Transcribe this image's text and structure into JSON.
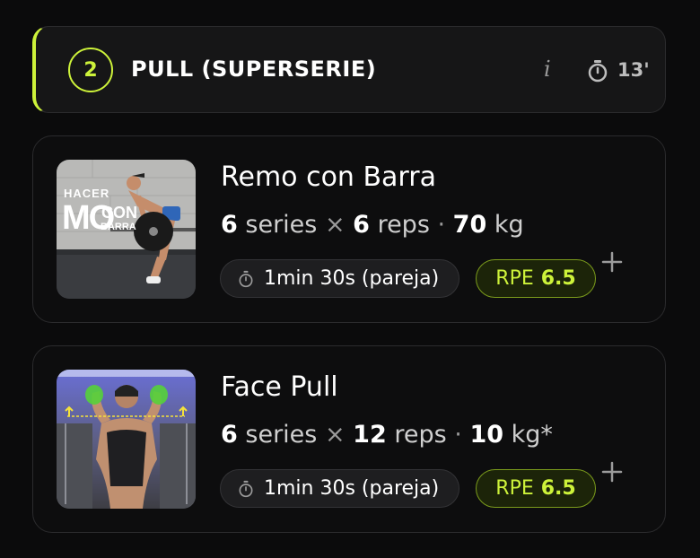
{
  "block": {
    "number": "2",
    "title": "PULL (SUPERSERIE)",
    "info_label": "i",
    "time": "13'",
    "accent_color": "#cdf23a"
  },
  "exercises": [
    {
      "name": "Remo con Barra",
      "thumbnail_text": [
        "HACER",
        "MO",
        "CON",
        "BARRA"
      ],
      "sets": "6",
      "sets_label": "series",
      "reps": "6",
      "reps_label": "reps",
      "weight": "70",
      "weight_unit": "kg",
      "rest": "1min 30s (pareja)",
      "rpe_label": "RPE",
      "rpe_value": "6.5"
    },
    {
      "name": "Face Pull",
      "sets": "6",
      "sets_label": "series",
      "reps": "12",
      "reps_label": "reps",
      "weight": "10",
      "weight_unit": "kg*",
      "rest": "1min 30s (pareja)",
      "rpe_label": "RPE",
      "rpe_value": "6.5"
    }
  ],
  "icons": {
    "timer": "stopwatch-icon",
    "info": "info-icon",
    "add": "plus-icon"
  }
}
